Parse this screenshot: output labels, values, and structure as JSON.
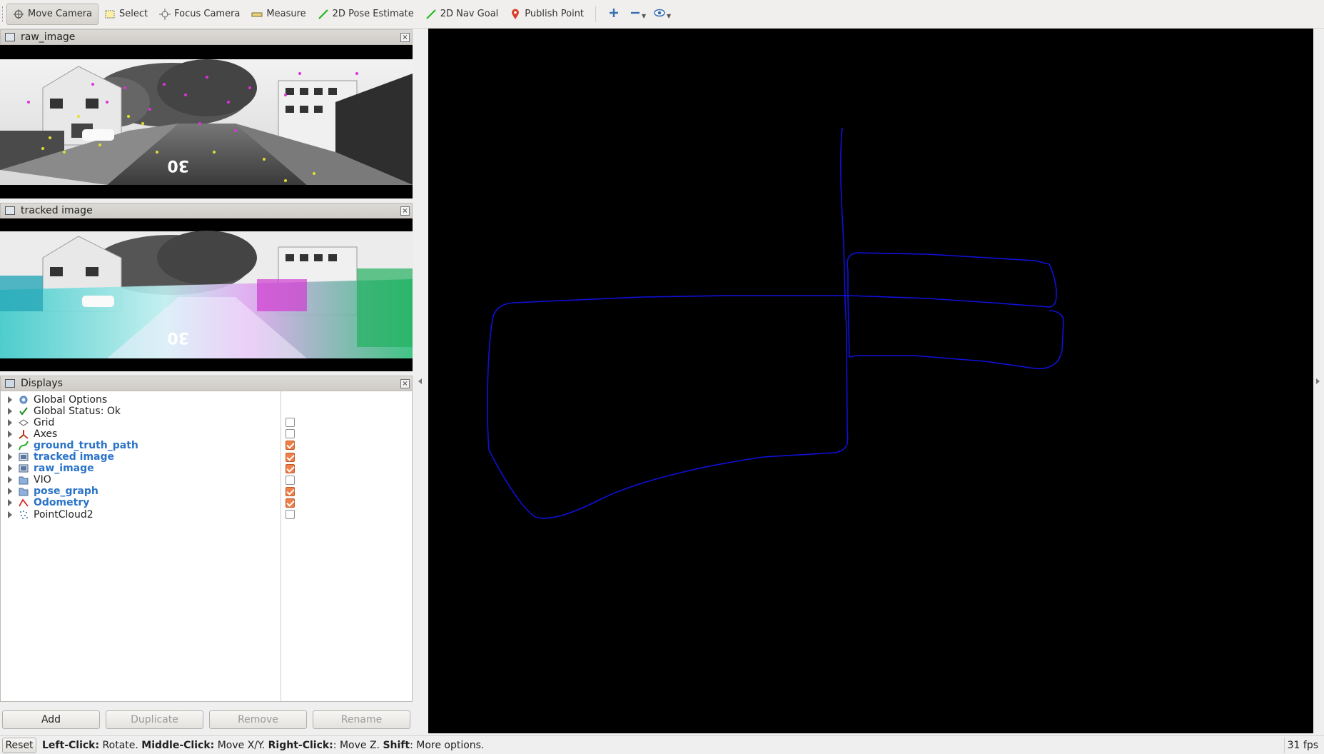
{
  "toolbar": {
    "tools": [
      {
        "label": "Move Camera",
        "icon": "move-camera-icon",
        "active": true
      },
      {
        "label": "Select",
        "icon": "select-icon"
      },
      {
        "label": "Focus Camera",
        "icon": "focus-camera-icon"
      },
      {
        "label": "Measure",
        "icon": "measure-icon"
      },
      {
        "label": "2D Pose Estimate",
        "icon": "pose-estimate-icon"
      },
      {
        "label": "2D Nav Goal",
        "icon": "nav-goal-icon"
      },
      {
        "label": "Publish Point",
        "icon": "publish-point-icon"
      }
    ]
  },
  "panels": {
    "raw_image": {
      "title": "raw_image"
    },
    "tracked_image": {
      "title": "tracked image"
    },
    "displays": {
      "title": "Displays"
    }
  },
  "displays": [
    {
      "label": "Global Options",
      "icon": "gear-icon",
      "enabled": null
    },
    {
      "label": "Global Status: Ok",
      "icon": "checkmark-icon",
      "enabled": null
    },
    {
      "label": "Grid",
      "icon": "grid-icon",
      "enabled": false
    },
    {
      "label": "Axes",
      "icon": "axes-icon",
      "enabled": false
    },
    {
      "label": "ground_truth_path",
      "icon": "path-icon",
      "enabled": true
    },
    {
      "label": "tracked image",
      "icon": "image-icon",
      "enabled": true
    },
    {
      "label": "raw_image",
      "icon": "image-icon",
      "enabled": true
    },
    {
      "label": "VIO",
      "icon": "folder-icon",
      "enabled": false
    },
    {
      "label": "pose_graph",
      "icon": "folder-icon",
      "enabled": true
    },
    {
      "label": "Odometry",
      "icon": "odometry-icon",
      "enabled": true
    },
    {
      "label": "PointCloud2",
      "icon": "pointcloud-icon",
      "enabled": false
    }
  ],
  "buttons": {
    "add": "Add",
    "duplicate": "Duplicate",
    "remove": "Remove",
    "rename": "Rename",
    "reset": "Reset"
  },
  "status": {
    "left_click": "Left-Click:",
    "left_action": " Rotate. ",
    "middle_click": "Middle-Click:",
    "middle_action": " Move X/Y. ",
    "right_click": "Right-Click:",
    "right_action": ": Move Z. ",
    "shift": "Shift",
    "shift_action": ": More options.",
    "fps": "31 fps"
  },
  "colors": {
    "path": "#1010dd",
    "checked": "#ee7f4a",
    "enabled_label": "#2a73c8"
  }
}
